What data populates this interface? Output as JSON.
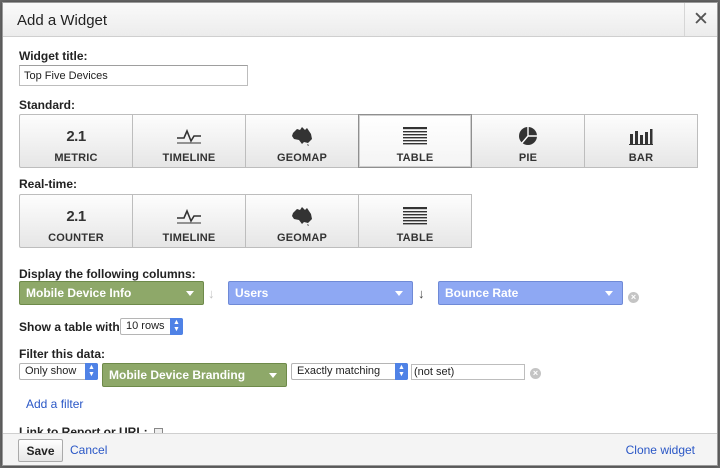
{
  "dialog": {
    "title": "Add a Widget",
    "close_icon": "close-icon"
  },
  "widget_title": {
    "label": "Widget title:",
    "value": "Top Five Devices"
  },
  "standard": {
    "label": "Standard:",
    "selected": "TABLE",
    "options": [
      {
        "icon": "number-icon",
        "number": "2.1",
        "label": "METRIC"
      },
      {
        "icon": "timeline-icon",
        "label": "TIMELINE"
      },
      {
        "icon": "geomap-icon",
        "label": "GEOMAP"
      },
      {
        "icon": "table-icon",
        "label": "TABLE"
      },
      {
        "icon": "pie-icon",
        "label": "PIE"
      },
      {
        "icon": "bar-chart-icon",
        "label": "BAR"
      }
    ]
  },
  "realtime": {
    "label": "Real-time:",
    "options": [
      {
        "icon": "number-icon",
        "number": "2.1",
        "label": "COUNTER"
      },
      {
        "icon": "timeline-icon",
        "label": "TIMELINE"
      },
      {
        "icon": "geomap-icon",
        "label": "GEOMAP"
      },
      {
        "icon": "table-icon",
        "label": "TABLE"
      }
    ]
  },
  "columns": {
    "label": "Display the following columns:",
    "items": [
      {
        "value": "Mobile Device Info",
        "kind": "dimension",
        "color": "#8ea869"
      },
      {
        "value": "Users",
        "kind": "metric",
        "color": "#8ea8f3"
      },
      {
        "value": "Bounce Rate",
        "kind": "metric",
        "color": "#8ea8f3"
      }
    ]
  },
  "show_table": {
    "label": "Show a table with",
    "value": "10 rows"
  },
  "filter": {
    "label": "Filter this data:",
    "mode": "Only show",
    "dimension": "Mobile Device Branding",
    "match": "Exactly matching",
    "value": "(not set)",
    "add_link": "Add a filter"
  },
  "link_section": {
    "label": "Link to Report or URL:"
  },
  "footer": {
    "save_label": "Save",
    "cancel_label": "Cancel",
    "clone_label": "Clone widget"
  }
}
